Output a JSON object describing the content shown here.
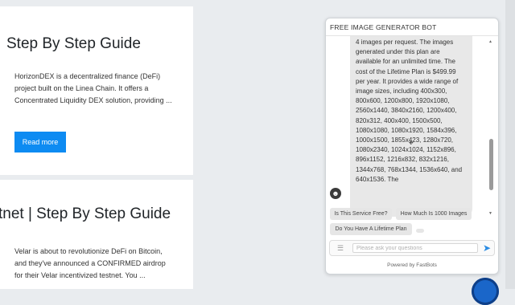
{
  "articles": [
    {
      "title": "Step By Step Guide",
      "excerpt": "HorizonDEX is a decentralized finance (DeFi) project built on the Linea Chain. It offers a Concentrated Liquidity DEX solution, providing ...",
      "button": "Read more"
    },
    {
      "title": "tnet | Step By Step Guide",
      "excerpt": "Velar is about to revolutionize DeFi on Bitcoin, and they've announced a CONFIRMED airdrop for their Velar incentivized testnet. You ..."
    }
  ],
  "chatbot": {
    "title": "FREE IMAGE GENERATOR BOT",
    "message": "4 images per request. The images generated under this plan are available for an unlimited time. The cost of the Lifetime Plan is $499.99 per year. It provides a wide range of image sizes, including 400x300, 800x600, 1200x800, 1920x1080, 2560x1440, 3840x2160, 1200x400, 820x312, 400x400, 1500x500, 1080x1080, 1080x1920, 1584x396, 1000x1500, 1855x423, 1280x720, 1080x2340, 1024x1024, 1152x896, 896x1152, 1216x832, 832x1216, 1344x768, 768x1344, 1536x640, and 640x1536. The",
    "suggestions": [
      "Is This Service Free?",
      "How Much Is 1000 Images",
      "Do You Have A Lifetime Plan"
    ],
    "input_placeholder": "Please ask your questions",
    "powered_by": "Powered by FastBots"
  },
  "colors": {
    "button": "#0d8bf2",
    "send": "#2a8be3",
    "fab": "#1a66c9"
  },
  "icons": [
    "bot-avatar-icon",
    "menu-icon",
    "send-icon",
    "scroll-up-icon",
    "scroll-down-icon",
    "chat-launcher-icon",
    "cursor-icon"
  ]
}
